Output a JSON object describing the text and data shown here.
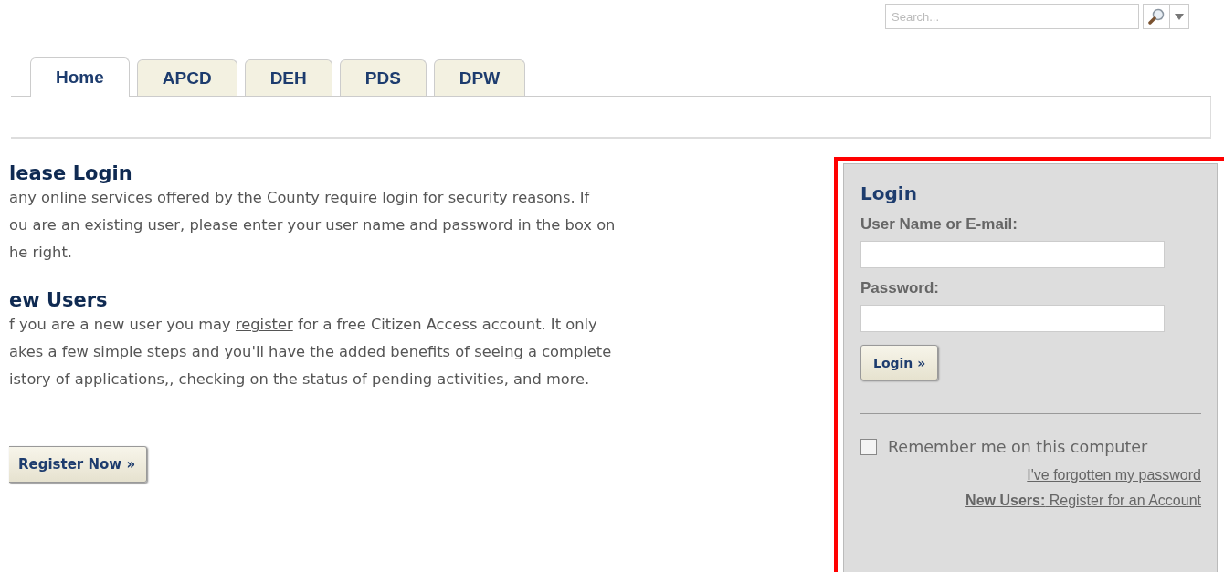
{
  "search": {
    "placeholder": "Search..."
  },
  "tabs": [
    {
      "label": "Home",
      "selected": true
    },
    {
      "label": "APCD",
      "selected": false
    },
    {
      "label": "DEH",
      "selected": false
    },
    {
      "label": "PDS",
      "selected": false
    },
    {
      "label": "DPW",
      "selected": false
    }
  ],
  "please_login": {
    "heading": "lease Login",
    "lines": [
      {
        "text": "any online services offered by the County require login for security reasons. If"
      },
      {
        "text": "ou are an existing user, please enter your user name and password in the box on"
      },
      {
        "text": "he right."
      }
    ]
  },
  "new_users": {
    "heading": "ew Users",
    "lines": [
      {
        "text": "f you are a new user you may",
        "link": "register",
        "rest": "for a free Citizen Access account. It only"
      },
      {
        "text": "akes a few simple steps and you'll have the added benefits of seeing a complete"
      },
      {
        "text": "istory of applications,, checking on the status of pending activities, and more."
      }
    ]
  },
  "register_button": "Register Now »",
  "login_panel": {
    "title": "Login",
    "username_label": "User Name or E-mail:",
    "password_label": "Password:",
    "login_button": "Login »",
    "remember": {
      "label": "Remember me on this computer",
      "checked": false
    },
    "forgot_link": "I've forgotten my password",
    "new_users_label": "New Users:",
    "register_link": "Register for an Account"
  }
}
